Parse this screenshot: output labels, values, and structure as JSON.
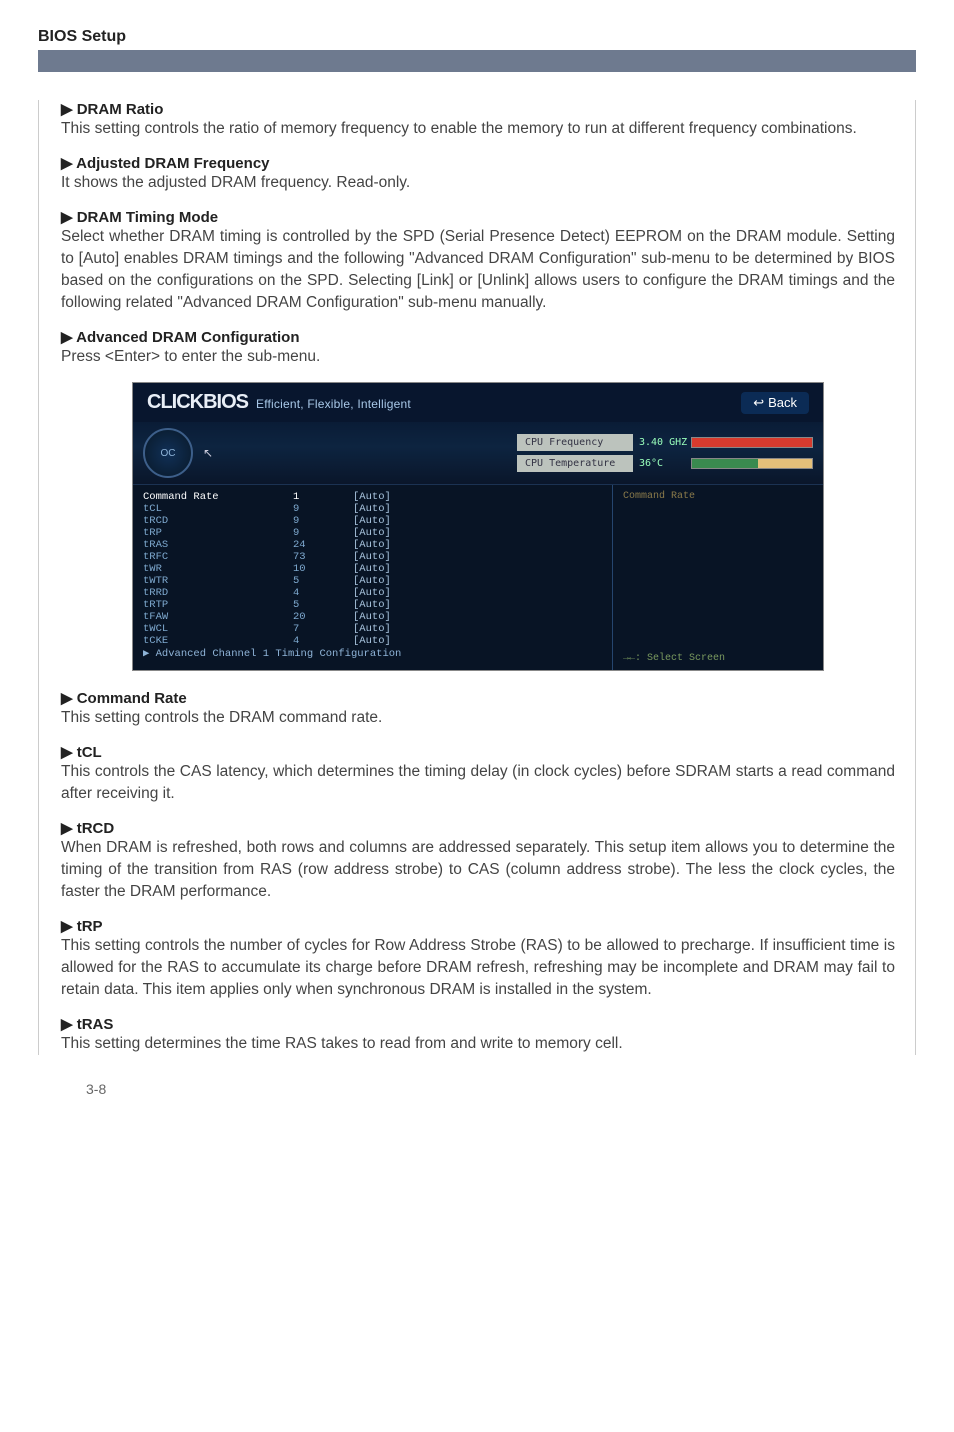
{
  "header": {
    "title": "BIOS Setup"
  },
  "s1": {
    "title": "▶ DRAM Ratio",
    "text": "This setting controls the ratio of memory frequency to enable the memory to run at different frequency combinations."
  },
  "s2": {
    "title": "▶ Adjusted DRAM Frequency",
    "text": "It shows the adjusted DRAM frequency. Read-only."
  },
  "s3": {
    "title": "▶ DRAM Timing Mode",
    "text": "Select whether DRAM timing is controlled by the SPD (Serial Presence Detect) EEPROM on the DRAM module. Setting to [Auto] enables DRAM timings and the following \"Advanced DRAM Configuration\" sub-menu to be determined by BIOS based on the configurations on the SPD. Selecting [Link] or [Unlink] allows users to configure the DRAM timings and the following related \"Advanced DRAM Configuration\" sub-menu manually."
  },
  "s4": {
    "title": "▶ Advanced DRAM Configuration",
    "text": "Press <Enter> to enter the sub-menu."
  },
  "bios": {
    "logo": "CLICKBIOS",
    "tagline": "Efficient, Flexible, Intelligent",
    "back": "Back",
    "dial": "OC",
    "readout_freq_label": "CPU Frequency",
    "readout_freq_value": "3.40 GHZ",
    "readout_temp_label": "CPU Temperature",
    "readout_temp_value": "36°C",
    "help_label": "Command Rate",
    "hint": "→←: Select Screen",
    "rows": [
      {
        "name": "Command Rate",
        "cur": "1",
        "val": "[Auto]",
        "hi": true
      },
      {
        "name": "tCL",
        "cur": "9",
        "val": "[Auto]"
      },
      {
        "name": "tRCD",
        "cur": "9",
        "val": "[Auto]"
      },
      {
        "name": "tRP",
        "cur": "9",
        "val": "[Auto]"
      },
      {
        "name": "tRAS",
        "cur": "24",
        "val": "[Auto]"
      },
      {
        "name": "tRFC",
        "cur": "73",
        "val": "[Auto]"
      },
      {
        "name": "tWR",
        "cur": "10",
        "val": "[Auto]"
      },
      {
        "name": "tWTR",
        "cur": "5",
        "val": "[Auto]"
      },
      {
        "name": "tRRD",
        "cur": "4",
        "val": "[Auto]"
      },
      {
        "name": "tRTP",
        "cur": "5",
        "val": "[Auto]"
      },
      {
        "name": "tFAW",
        "cur": "20",
        "val": "[Auto]"
      },
      {
        "name": "tWCL",
        "cur": "7",
        "val": "[Auto]"
      },
      {
        "name": "tCKE",
        "cur": "4",
        "val": "[Auto]"
      }
    ],
    "advanced_row": "▶ Advanced Channel 1 Timing Configuration"
  },
  "s5": {
    "title": "▶ Command Rate",
    "text": "This setting controls the DRAM command rate."
  },
  "s6": {
    "title": "▶ tCL",
    "text": "This controls the CAS latency, which determines the timing delay (in clock cycles) before SDRAM starts a read command after receiving it."
  },
  "s7": {
    "title": "▶ tRCD",
    "text": "When DRAM is refreshed, both rows and columns are addressed separately. This setup item allows you to determine the timing of the transition from RAS (row address strobe) to CAS (column address strobe). The less the clock cycles, the faster the DRAM performance."
  },
  "s8": {
    "title": "▶ tRP",
    "text": "This setting controls the number of cycles for Row Address Strobe (RAS) to be allowed to precharge. If insufficient time is allowed for the RAS to accumulate its charge before DRAM refresh, refreshing may be incomplete and DRAM may fail to retain data. This item applies only when synchronous DRAM is installed in the system."
  },
  "s9": {
    "title": "▶ tRAS",
    "text": "This setting determines the time RAS takes to read from and write to memory cell."
  },
  "page_number": "3-8"
}
